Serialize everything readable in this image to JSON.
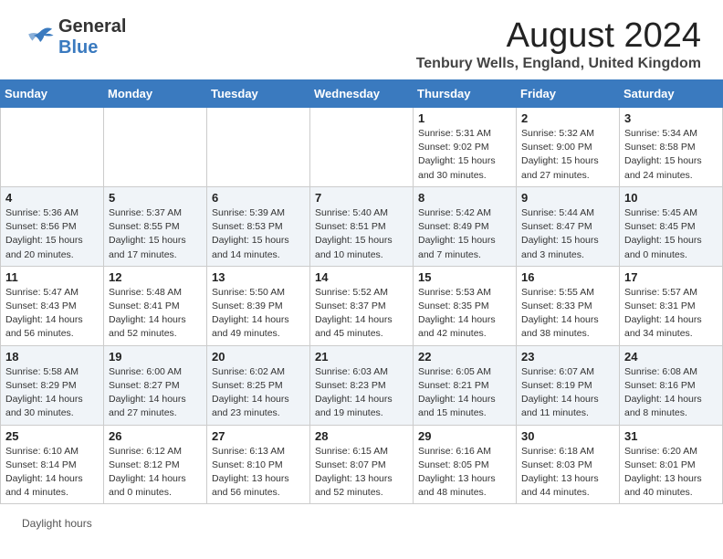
{
  "header": {
    "logo_general": "General",
    "logo_blue": "Blue",
    "month_title": "August 2024",
    "location": "Tenbury Wells, England, United Kingdom"
  },
  "days_of_week": [
    "Sunday",
    "Monday",
    "Tuesday",
    "Wednesday",
    "Thursday",
    "Friday",
    "Saturday"
  ],
  "weeks": [
    [
      {
        "day": "",
        "info": ""
      },
      {
        "day": "",
        "info": ""
      },
      {
        "day": "",
        "info": ""
      },
      {
        "day": "",
        "info": ""
      },
      {
        "day": "1",
        "info": "Sunrise: 5:31 AM\nSunset: 9:02 PM\nDaylight: 15 hours and 30 minutes."
      },
      {
        "day": "2",
        "info": "Sunrise: 5:32 AM\nSunset: 9:00 PM\nDaylight: 15 hours and 27 minutes."
      },
      {
        "day": "3",
        "info": "Sunrise: 5:34 AM\nSunset: 8:58 PM\nDaylight: 15 hours and 24 minutes."
      }
    ],
    [
      {
        "day": "4",
        "info": "Sunrise: 5:36 AM\nSunset: 8:56 PM\nDaylight: 15 hours and 20 minutes."
      },
      {
        "day": "5",
        "info": "Sunrise: 5:37 AM\nSunset: 8:55 PM\nDaylight: 15 hours and 17 minutes."
      },
      {
        "day": "6",
        "info": "Sunrise: 5:39 AM\nSunset: 8:53 PM\nDaylight: 15 hours and 14 minutes."
      },
      {
        "day": "7",
        "info": "Sunrise: 5:40 AM\nSunset: 8:51 PM\nDaylight: 15 hours and 10 minutes."
      },
      {
        "day": "8",
        "info": "Sunrise: 5:42 AM\nSunset: 8:49 PM\nDaylight: 15 hours and 7 minutes."
      },
      {
        "day": "9",
        "info": "Sunrise: 5:44 AM\nSunset: 8:47 PM\nDaylight: 15 hours and 3 minutes."
      },
      {
        "day": "10",
        "info": "Sunrise: 5:45 AM\nSunset: 8:45 PM\nDaylight: 15 hours and 0 minutes."
      }
    ],
    [
      {
        "day": "11",
        "info": "Sunrise: 5:47 AM\nSunset: 8:43 PM\nDaylight: 14 hours and 56 minutes."
      },
      {
        "day": "12",
        "info": "Sunrise: 5:48 AM\nSunset: 8:41 PM\nDaylight: 14 hours and 52 minutes."
      },
      {
        "day": "13",
        "info": "Sunrise: 5:50 AM\nSunset: 8:39 PM\nDaylight: 14 hours and 49 minutes."
      },
      {
        "day": "14",
        "info": "Sunrise: 5:52 AM\nSunset: 8:37 PM\nDaylight: 14 hours and 45 minutes."
      },
      {
        "day": "15",
        "info": "Sunrise: 5:53 AM\nSunset: 8:35 PM\nDaylight: 14 hours and 42 minutes."
      },
      {
        "day": "16",
        "info": "Sunrise: 5:55 AM\nSunset: 8:33 PM\nDaylight: 14 hours and 38 minutes."
      },
      {
        "day": "17",
        "info": "Sunrise: 5:57 AM\nSunset: 8:31 PM\nDaylight: 14 hours and 34 minutes."
      }
    ],
    [
      {
        "day": "18",
        "info": "Sunrise: 5:58 AM\nSunset: 8:29 PM\nDaylight: 14 hours and 30 minutes."
      },
      {
        "day": "19",
        "info": "Sunrise: 6:00 AM\nSunset: 8:27 PM\nDaylight: 14 hours and 27 minutes."
      },
      {
        "day": "20",
        "info": "Sunrise: 6:02 AM\nSunset: 8:25 PM\nDaylight: 14 hours and 23 minutes."
      },
      {
        "day": "21",
        "info": "Sunrise: 6:03 AM\nSunset: 8:23 PM\nDaylight: 14 hours and 19 minutes."
      },
      {
        "day": "22",
        "info": "Sunrise: 6:05 AM\nSunset: 8:21 PM\nDaylight: 14 hours and 15 minutes."
      },
      {
        "day": "23",
        "info": "Sunrise: 6:07 AM\nSunset: 8:19 PM\nDaylight: 14 hours and 11 minutes."
      },
      {
        "day": "24",
        "info": "Sunrise: 6:08 AM\nSunset: 8:16 PM\nDaylight: 14 hours and 8 minutes."
      }
    ],
    [
      {
        "day": "25",
        "info": "Sunrise: 6:10 AM\nSunset: 8:14 PM\nDaylight: 14 hours and 4 minutes."
      },
      {
        "day": "26",
        "info": "Sunrise: 6:12 AM\nSunset: 8:12 PM\nDaylight: 14 hours and 0 minutes."
      },
      {
        "day": "27",
        "info": "Sunrise: 6:13 AM\nSunset: 8:10 PM\nDaylight: 13 hours and 56 minutes."
      },
      {
        "day": "28",
        "info": "Sunrise: 6:15 AM\nSunset: 8:07 PM\nDaylight: 13 hours and 52 minutes."
      },
      {
        "day": "29",
        "info": "Sunrise: 6:16 AM\nSunset: 8:05 PM\nDaylight: 13 hours and 48 minutes."
      },
      {
        "day": "30",
        "info": "Sunrise: 6:18 AM\nSunset: 8:03 PM\nDaylight: 13 hours and 44 minutes."
      },
      {
        "day": "31",
        "info": "Sunrise: 6:20 AM\nSunset: 8:01 PM\nDaylight: 13 hours and 40 minutes."
      }
    ]
  ],
  "footer": {
    "text": "Daylight hours"
  }
}
